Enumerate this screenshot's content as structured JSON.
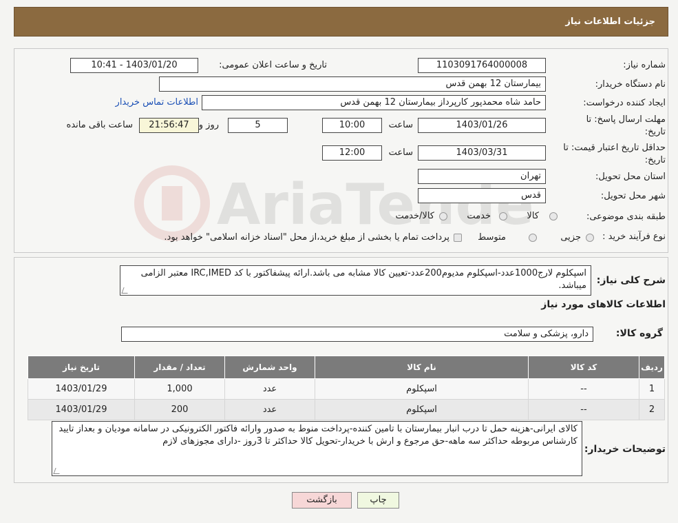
{
  "header": {
    "title": "جزئیات اطلاعات نیاز"
  },
  "form": {
    "need_number_label": "شماره نیاز:",
    "need_number": "1103091764000008",
    "announce_label": "تاریخ و ساعت اعلان عمومی:",
    "announce_value": "1403/01/20 - 10:41",
    "buyer_org_label": "نام دستگاه خریدار:",
    "buyer_org": "بیمارستان 12 بهمن قدس",
    "requester_label": "ایجاد کننده درخواست:",
    "requester": "حامد شاه محمدپور کارپرداز بیمارستان 12 بهمن قدس",
    "contact_link": "اطلاعات تماس خریدار",
    "deadline_label_1": "مهلت ارسال پاسخ: تا",
    "deadline_label_2": "تاریخ:",
    "deadline_date": "1403/01/26",
    "time_label": "ساعت",
    "deadline_time": "10:00",
    "days_value": "5",
    "days_label": "روز و",
    "remaining_time": "21:56:47",
    "remaining_label": "ساعت باقی مانده",
    "validity_label_1": "حداقل تاریخ اعتبار قیمت: تا",
    "validity_label_2": "تاریخ:",
    "validity_date": "1403/03/31",
    "validity_time": "12:00",
    "province_label": "استان محل تحویل:",
    "province": "تهران",
    "city_label": "شهر محل تحویل:",
    "city": "قدس",
    "category_label": "طبقه بندی موضوعی:",
    "category_options": [
      "کالا",
      "خدمت",
      "کالا/خدمت"
    ],
    "purchase_type_label": "نوع فرآیند خرید :",
    "purchase_options": [
      "جزیی",
      "متوسط"
    ],
    "purchase_note": "پرداخت تمام یا بخشی از مبلغ خرید،از محل \"اسناد خزانه اسلامی\" خواهد بود."
  },
  "description": {
    "label": "شرح کلی نیاز:",
    "text": "اسپکلوم لارج1000عدد-اسپکلوم مدیوم200عدد-تعیین کالا مشابه می باشد.ارائه پیشفاکتور با کد IRC,IMED معتبر الزامی میباشد."
  },
  "goods_section": {
    "title": "اطلاعات کالاهای مورد نیاز",
    "group_label": "گروه کالا:",
    "group_value": "دارو، پزشکی و سلامت"
  },
  "table": {
    "headers": [
      "ردیف",
      "کد کالا",
      "نام کالا",
      "واحد شمارش",
      "تعداد / مقدار",
      "تاریخ نیاز"
    ],
    "rows": [
      [
        "1",
        "--",
        "اسپکلوم",
        "عدد",
        "1,000",
        "1403/01/29"
      ],
      [
        "2",
        "--",
        "اسپکلوم",
        "عدد",
        "200",
        "1403/01/29"
      ]
    ]
  },
  "buyer_notes": {
    "label": "توضیحات خریدار:",
    "text": "کالای ایرانی-هزینه حمل تا درب  انبار بیمارستان با تامین کننده-پرداخت منوط به صدور وارائه فاکتور الکترونیکی در سامانه مودیان و بعداز تایید کارشناس مربوطه حداکثر سه ماهه-حق مرجوع و ارش با خریدار-تحویل کالا حداکثر تا 3روز   -دارای مجوزهای لازم"
  },
  "buttons": {
    "print": "چاپ",
    "back": "بازگشت"
  },
  "colors": {
    "header_bg": "#8b6a40",
    "table_header_bg": "#7b7b7b",
    "back_button_bg": "#f7d7d7",
    "print_button_bg": "#f0f8e0",
    "link": "#1a4fb5"
  }
}
